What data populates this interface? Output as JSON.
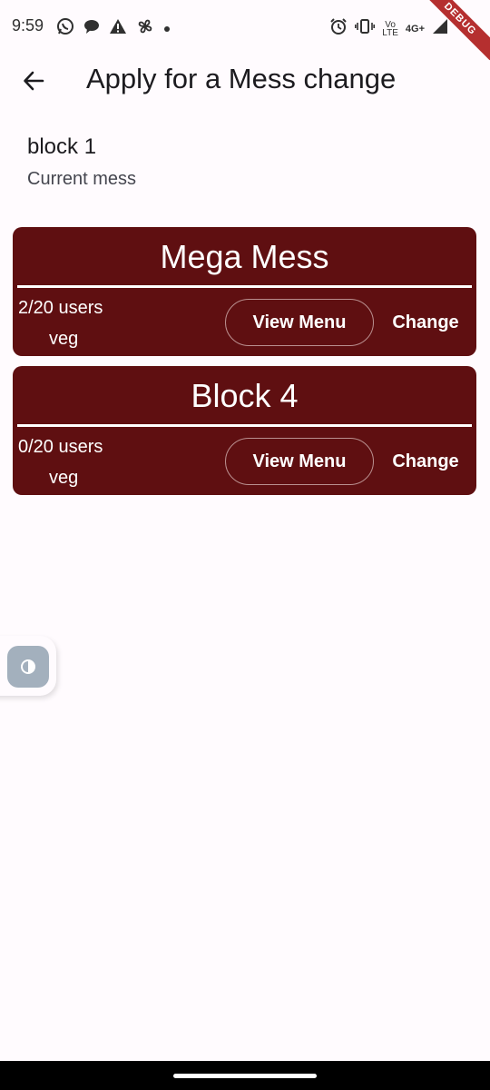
{
  "status_bar": {
    "time": "9:59",
    "network_top": "Vo",
    "network_bottom": "LTE",
    "network_type": "4G+",
    "debug_banner": "DEBUG",
    "icons": [
      "whatsapp-icon",
      "chat-icon",
      "warning-icon",
      "pinwheel-icon",
      "dot-icon",
      "alarm-icon",
      "vibrate-icon",
      "signal-icon",
      "battery-icon"
    ]
  },
  "app_bar": {
    "title": "Apply for a Mess change",
    "back_icon": "arrow-left-icon"
  },
  "current": {
    "name": "block 1",
    "label": "Current mess"
  },
  "messes": [
    {
      "name": "Mega Mess",
      "users": "2/20 users",
      "type": "veg",
      "view_menu_label": "View Menu",
      "change_label": "Change"
    },
    {
      "name": "Block 4",
      "users": "0/20 users",
      "type": "veg",
      "view_menu_label": "View Menu",
      "change_label": "Change"
    }
  ],
  "theme_toggle": {
    "icon": "contrast-icon"
  },
  "colors": {
    "card_bg": "#5f0f11",
    "page_bg": "#fffbfe",
    "toggle_bg": "#a3b0bd",
    "debug_ribbon": "#b52f2f"
  }
}
